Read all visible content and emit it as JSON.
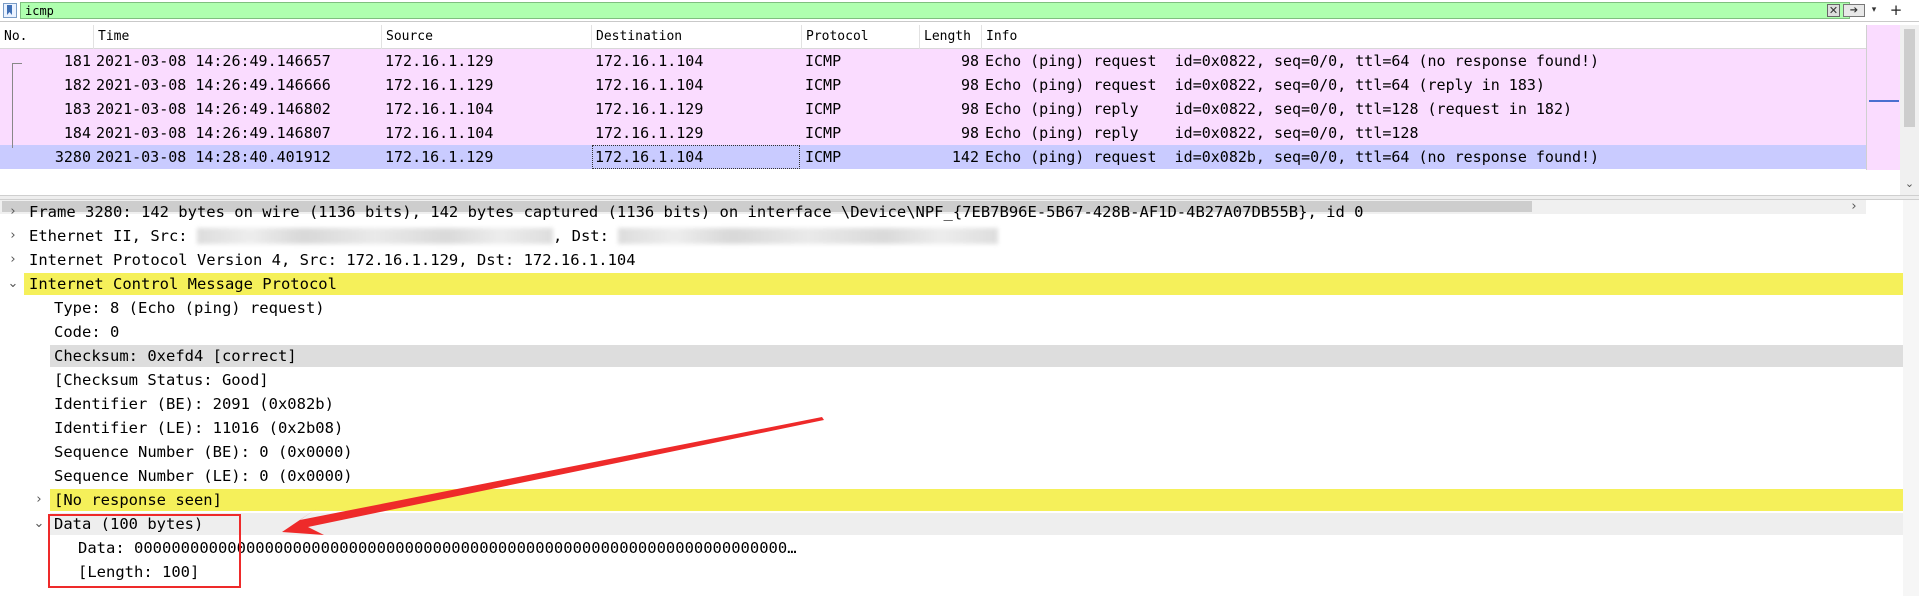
{
  "filter": {
    "value": "icmp",
    "clear_glyph": "✕",
    "apply_glyph": "➔",
    "dropdown_glyph": "▾",
    "add_glyph": "+"
  },
  "packet_list": {
    "columns": [
      "No.",
      "Time",
      "Source",
      "Destination",
      "Protocol",
      "Length",
      "Info"
    ],
    "rows": [
      {
        "no": "181",
        "time": "2021-03-08 14:26:49.146657",
        "source": "172.16.1.129",
        "destination": "172.16.1.104",
        "protocol": "ICMP",
        "length": "98",
        "info": "Echo (ping) request  id=0x0822, seq=0/0, ttl=64 (no response found!)"
      },
      {
        "no": "182",
        "time": "2021-03-08 14:26:49.146666",
        "source": "172.16.1.129",
        "destination": "172.16.1.104",
        "protocol": "ICMP",
        "length": "98",
        "info": "Echo (ping) request  id=0x0822, seq=0/0, ttl=64 (reply in 183)"
      },
      {
        "no": "183",
        "time": "2021-03-08 14:26:49.146802",
        "source": "172.16.1.104",
        "destination": "172.16.1.129",
        "protocol": "ICMP",
        "length": "98",
        "info": "Echo (ping) reply    id=0x0822, seq=0/0, ttl=128 (request in 182)"
      },
      {
        "no": "184",
        "time": "2021-03-08 14:26:49.146807",
        "source": "172.16.1.104",
        "destination": "172.16.1.129",
        "protocol": "ICMP",
        "length": "98",
        "info": "Echo (ping) reply    id=0x0822, seq=0/0, ttl=128"
      },
      {
        "no": "3280",
        "time": "2021-03-08 14:28:40.401912",
        "source": "172.16.1.129",
        "destination": "172.16.1.104",
        "protocol": "ICMP",
        "length": "142",
        "info": "Echo (ping) request  id=0x082b, seq=0/0, ttl=64 (no response found!)"
      }
    ],
    "scroll_right_glyph": "›",
    "scroll_down_glyph": "⌄"
  },
  "details": {
    "frame": "Frame 3280: 142 bytes on wire (1136 bits), 142 bytes captured (1136 bits) on interface \\Device\\NPF_{7EB7B96E-5B67-428B-AF1D-4B27A07DB55B}, id 0",
    "ethernet_prefix": "Ethernet II, Src:",
    "ethernet_dst": ", Dst:",
    "ip": "Internet Protocol Version 4, Src: 172.16.1.129, Dst: 172.16.1.104",
    "icmp": "Internet Control Message Protocol",
    "type": "Type: 8 (Echo (ping) request)",
    "code": "Code: 0",
    "checksum": "Checksum: 0xefd4 [correct]",
    "checksum_status": "[Checksum Status: Good]",
    "identifier_be": "Identifier (BE): 2091 (0x082b)",
    "identifier_le": "Identifier (LE): 11016 (0x2b08)",
    "sequence_be": "Sequence Number (BE): 0 (0x0000)",
    "sequence_le": "Sequence Number (LE): 0 (0x0000)",
    "no_response": "[No response seen]",
    "data_header": "Data (100 bytes)",
    "data_value": "Data: 0000000000000000000000000000000000000000000000000000000000000000000000…",
    "data_length": "[Length: 100]",
    "collapsed_glyph": "›",
    "expanded_glyph": "⌄"
  },
  "colors": {
    "filter_valid": "#afffaf",
    "row_icmp": "#fadcff",
    "row_selected": "#c9cbff",
    "highlight_yellow": "#f5f05a",
    "annotation_red": "#ee2a2a"
  }
}
